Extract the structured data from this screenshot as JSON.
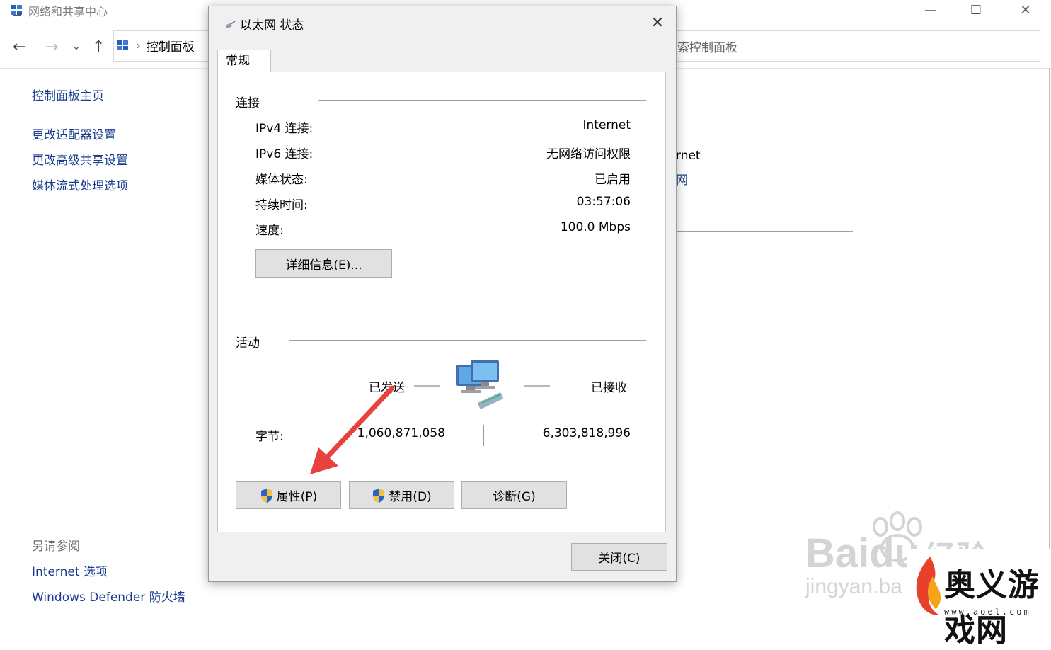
{
  "window": {
    "title": "网络和共享中心",
    "minimize": "—",
    "maximize": "☐",
    "close": "✕"
  },
  "address": {
    "breadcrumb": "控制面板",
    "separator": "›",
    "search_placeholder": "搜索控制面板"
  },
  "sidebar": {
    "home": "控制面板主页",
    "items": [
      {
        "label": "更改适配器设置"
      },
      {
        "label": "更改高级共享设置"
      },
      {
        "label": "媒体流式处理选项"
      }
    ],
    "see_also_title": "另请参阅",
    "see_also": [
      {
        "label": "Internet 选项"
      },
      {
        "label": "Windows Defender 防火墙"
      }
    ]
  },
  "background_content": {
    "partial_text_1": "rnet",
    "partial_link_1": "网"
  },
  "dialog": {
    "title": "以太网 状态",
    "close_glyph": "✕",
    "tab": "常规",
    "connection": {
      "heading": "连接",
      "rows": [
        {
          "label": "IPv4 连接:",
          "value": "Internet"
        },
        {
          "label": "IPv6 连接:",
          "value": "无网络访问权限"
        },
        {
          "label": "媒体状态:",
          "value": "已启用"
        },
        {
          "label": "持续时间:",
          "value": "03:57:06"
        },
        {
          "label": "速度:",
          "value": "100.0 Mbps"
        }
      ],
      "details_button": "详细信息(E)..."
    },
    "activity": {
      "heading": "活动",
      "sent_label": "已发送",
      "received_label": "已接收",
      "bytes_label": "字节:",
      "bytes_sent": "1,060,871,058",
      "bytes_received": "6,303,818,996"
    },
    "buttons": {
      "properties": "属性(P)",
      "disable": "禁用(D)",
      "diagnose": "诊断(G)",
      "close": "关闭(C)"
    }
  },
  "watermark": {
    "baidu": "Baidu",
    "jingyan": "经验",
    "url": "jingyan.ba",
    "brand": "奥义游戏网",
    "brand_url": "www.aoel.com"
  },
  "colors": {
    "link": "#1a3d8f",
    "arrow": "#e8413e",
    "button_face": "#e1e1e1"
  }
}
